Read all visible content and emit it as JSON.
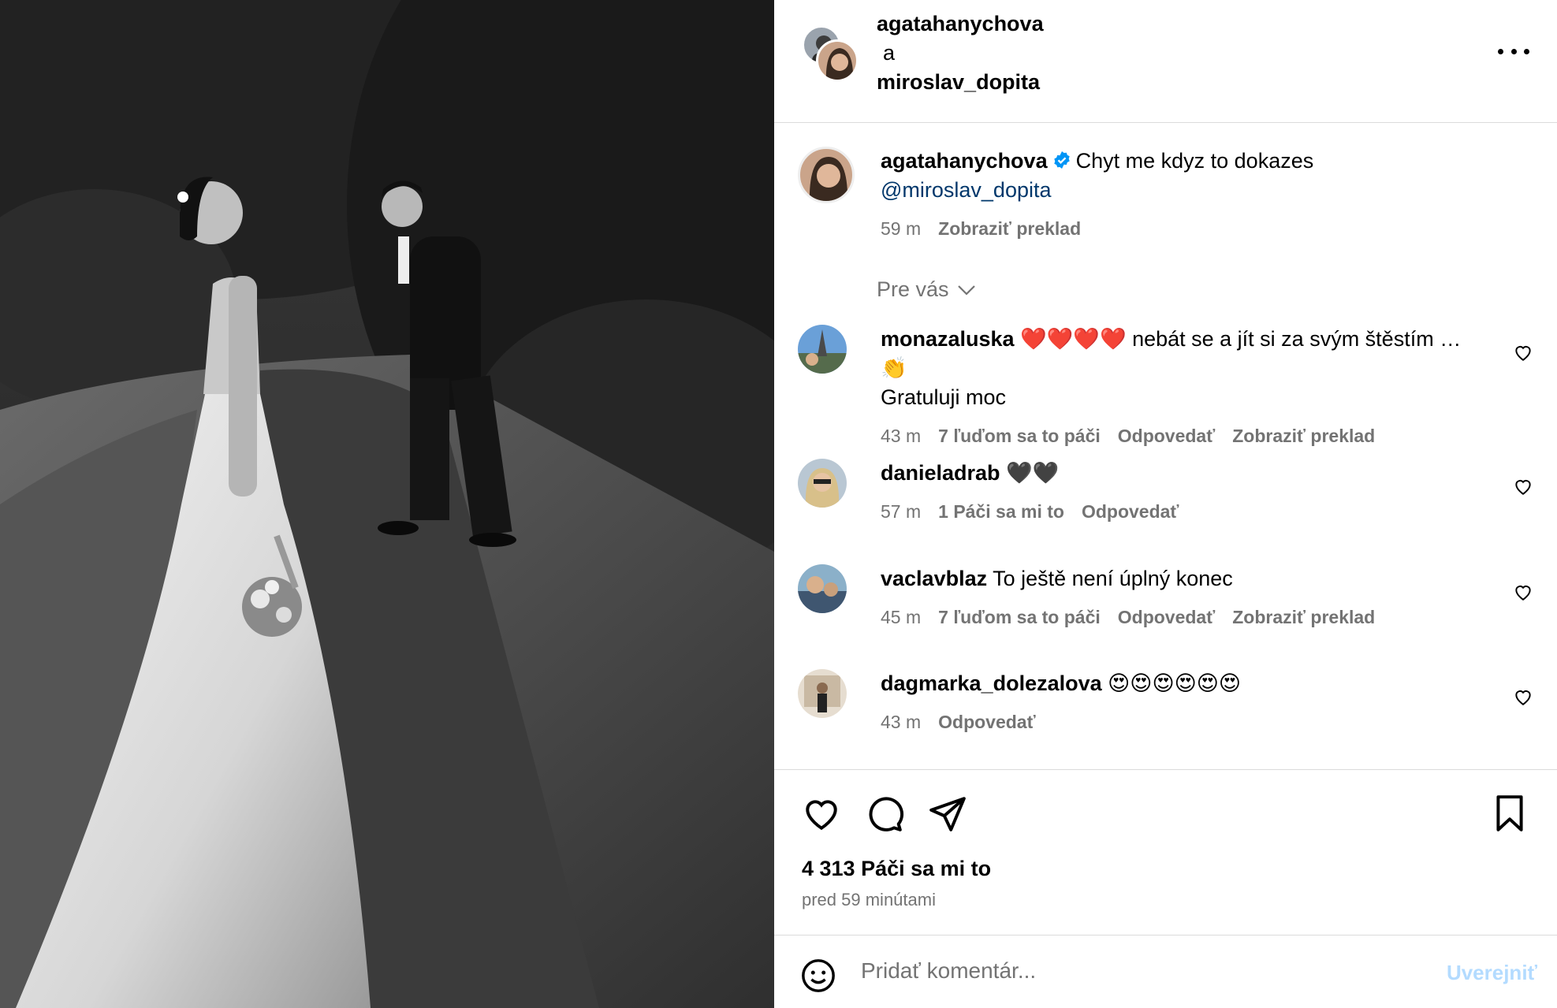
{
  "header": {
    "user1": "agatahanychova",
    "connector": "a",
    "user2": "miroslav_dopita",
    "more_icon": "more-horizontal-icon"
  },
  "caption": {
    "username": "agatahanychova",
    "verified": true,
    "text": "Chyt me kdyz to dokazes",
    "mention": "@miroslav_dopita",
    "time": "59 m",
    "translate": "Zobraziť preklad"
  },
  "filter": {
    "label": "Pre vás"
  },
  "comments": [
    {
      "username": "monazaluska",
      "text": "❤️❤️❤️❤️ nebát se a jít si za svým štěstím … 👏",
      "text2": "Gratuluji moc",
      "time": "43 m",
      "likes": "7 ľuďom sa to páči",
      "reply": "Odpovedať",
      "translate": "Zobraziť preklad"
    },
    {
      "username": "danieladrab",
      "text": "🖤🖤",
      "time": "57 m",
      "likes": "1 Páči sa mi to",
      "reply": "Odpovedať"
    },
    {
      "username": "vaclavblaz",
      "text": "To ještě není úplný konec",
      "time": "45 m",
      "likes": "7 ľuďom sa to páči",
      "reply": "Odpovedať",
      "translate": "Zobraziť preklad"
    },
    {
      "username": "dagmarka_dolezalova",
      "text": "😍😍😍😍😍😍",
      "time": "43 m",
      "reply": "Odpovedať"
    }
  ],
  "actions": {
    "like_count": "4 313 Páči sa mi to",
    "posted": "pred 59 minútami"
  },
  "comment_box": {
    "placeholder": "Pridať komentár...",
    "post_label": "Uverejniť"
  },
  "colors": {
    "link": "#00376b",
    "muted": "#737373",
    "verified": "#0095f6",
    "post_disabled": "#b3dbff"
  }
}
